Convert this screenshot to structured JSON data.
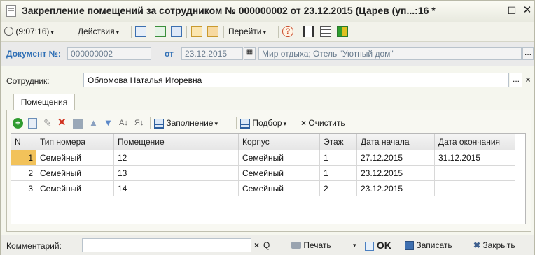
{
  "window": {
    "title": "Закрепление помещений за сотрудником № 000000002 от 23.12.2015 (Царев (уп...:16 *",
    "minimize": "_",
    "maximize": "☐",
    "close": "✕"
  },
  "toolbar": {
    "time": "(9:07:16)",
    "actions": "Действия",
    "goto": "Перейти",
    "help": "?"
  },
  "document": {
    "number_label": "Документ №:",
    "number": "000000002",
    "from_label": "от",
    "date": "23.12.2015",
    "organization": "Мир отдыха; Отель \"Уютный дом\"",
    "select": "..."
  },
  "employee": {
    "label": "Сотрудник:",
    "value": "Обломова Наталья Игоревна",
    "select": "...",
    "clear": "×"
  },
  "tabs": [
    {
      "label": "Помещения"
    }
  ],
  "table_toolbar": {
    "fill": "Заполнение",
    "pick": "Подбор",
    "clear_x": "×",
    "clear": "Очистить"
  },
  "table": {
    "columns": [
      "N",
      "Тип номера",
      "Помещение",
      "Корпус",
      "Этаж",
      "Дата начала",
      "Дата окончания"
    ],
    "rows": [
      [
        "1",
        "Семейный",
        "12",
        "Семейный",
        "1",
        "27.12.2015",
        "31.12.2015"
      ],
      [
        "2",
        "Семейный",
        "13",
        "Семейный",
        "1",
        "23.12.2015",
        ""
      ],
      [
        "3",
        "Семейный",
        "14",
        "Семейный",
        "2",
        "23.12.2015",
        ""
      ]
    ]
  },
  "footer": {
    "comment_label": "Комментарий:",
    "comment_value": "",
    "clear_x": "×",
    "search": "Q",
    "print": "Печать",
    "ok": "OK",
    "save": "Записать",
    "close": "Закрыть"
  },
  "colors": {
    "selected_row_marker": "#f2c25a",
    "label_blue": "#2f6fb5"
  }
}
